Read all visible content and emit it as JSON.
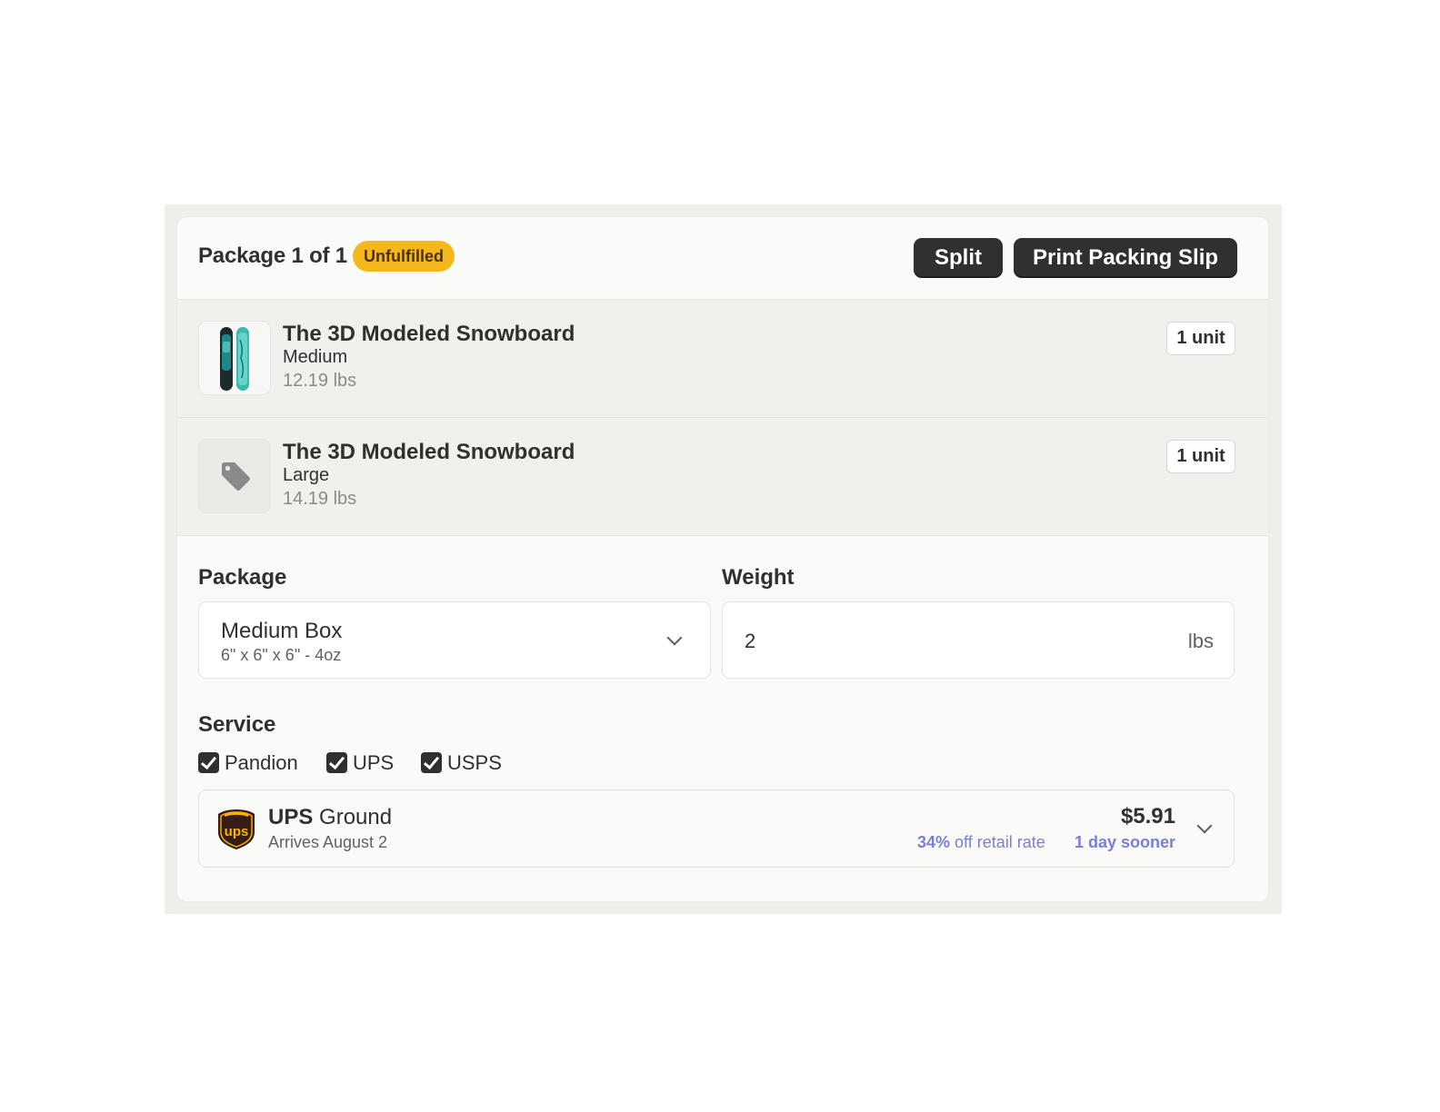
{
  "header": {
    "title": "Package 1 of 1",
    "status": "Unfulfilled",
    "split_label": "Split",
    "print_label": "Print Packing Slip"
  },
  "items": [
    {
      "name": "The 3D Modeled Snowboard",
      "variant": "Medium",
      "weight": "12.19 lbs",
      "quantity": "1 unit",
      "thumbnail": "snowboard-image"
    },
    {
      "name": "The 3D Modeled Snowboard",
      "variant": "Large",
      "weight": "14.19 lbs",
      "quantity": "1 unit",
      "thumbnail": "tag-icon"
    }
  ],
  "package": {
    "label": "Package",
    "selected": "Medium Box",
    "dimensions": "6\" x 6\" x 6\" - 4oz"
  },
  "weight": {
    "label": "Weight",
    "value": "2",
    "unit": "lbs"
  },
  "service": {
    "label": "Service",
    "carriers": [
      {
        "label": "Pandion",
        "checked": true
      },
      {
        "label": "UPS",
        "checked": true
      },
      {
        "label": "USPS",
        "checked": true
      }
    ],
    "rate": {
      "carrier": "UPS",
      "service": "Ground",
      "arrival": "Arrives August 2",
      "price": "$5.91",
      "discount_pct": "34%",
      "discount_text": "off retail rate",
      "speed": "1 day sooner"
    }
  },
  "colors": {
    "status_badge": "#f5b81c",
    "button_dark": "#303030",
    "accent_link": "#7b7fd0",
    "ups_brown": "#351c15",
    "ups_gold": "#ffb500"
  }
}
